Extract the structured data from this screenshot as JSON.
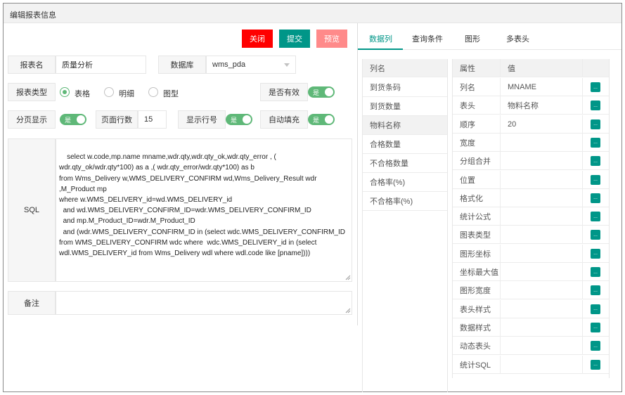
{
  "window": {
    "title": "编辑报表信息"
  },
  "toolbar": {
    "close_label": "关闭",
    "submit_label": "提交",
    "preview_label": "预览"
  },
  "colors": {
    "close": "#ff0000",
    "submit": "#009688",
    "preview": "#ff8a8a",
    "switch_on": "#5fb878",
    "accent": "#009688"
  },
  "form": {
    "report_name_label": "报表名",
    "report_name_value": "质量分析",
    "database_label": "数据库",
    "database_value": "wms_pda",
    "report_type_label": "报表类型",
    "report_type_options": [
      {
        "label": "表格",
        "selected": true
      },
      {
        "label": "明细",
        "selected": false
      },
      {
        "label": "图型",
        "selected": false
      }
    ],
    "valid_label": "是否有效",
    "valid_switch_text": "是",
    "paging_label": "分页显示",
    "paging_switch_text": "是",
    "page_rows_label": "页面行数",
    "page_rows_value": "15",
    "show_rownum_label": "显示行号",
    "show_rownum_switch_text": "是",
    "autofill_label": "自动填充",
    "autofill_switch_text": "是",
    "sql_label": "SQL",
    "sql_value": "select w.code,mp.name mname,wdr.qty,wdr.qty_ok,wdr.qty_error , ( wdr.qty_ok/wdr.qty*100) as a ,( wdr.qty_error/wdr.qty*100) as b\nfrom Wms_Delivery w,WMS_DELIVERY_CONFIRM wd,Wms_Delivery_Result wdr ,M_Product mp\nwhere w.WMS_DELIVERY_id=wd.WMS_DELIVERY_id\n  and wd.WMS_DELIVERY_CONFIRM_ID=wdr.WMS_DELIVERY_CONFIRM_ID\n  and mp.M_Product_ID=wdr.M_Product_ID\n  and (wdr.WMS_DELIVERY_CONFIRM_ID in (select wdc.WMS_DELIVERY_CONFIRM_ID from WMS_DELIVERY_CONFIRM wdc where  wdc.WMS_DELIVERY_id in (select wdl.WMS_DELIVERY_id from Wms_Delivery wdl where wdl.code like [pname])))",
    "remark_label": "备注",
    "remark_value": ""
  },
  "tabs": [
    {
      "label": "数据列",
      "active": true
    },
    {
      "label": "查询条件",
      "active": false
    },
    {
      "label": "图形",
      "active": false
    },
    {
      "label": "多表头",
      "active": false
    }
  ],
  "columns": {
    "header": "列名",
    "items": [
      {
        "label": "到货条码",
        "selected": false
      },
      {
        "label": "到货数量",
        "selected": false
      },
      {
        "label": "物料名称",
        "selected": true
      },
      {
        "label": "合格数量",
        "selected": false
      },
      {
        "label": "不合格数量",
        "selected": false
      },
      {
        "label": "合格率(%)",
        "selected": false
      },
      {
        "label": "不合格率(%)",
        "selected": false
      }
    ]
  },
  "properties": {
    "header_attr": "属性",
    "header_value": "值",
    "button_glyph": "...",
    "rows": [
      {
        "attr": "列名",
        "value": "MNAME"
      },
      {
        "attr": "表头",
        "value": "物料名称"
      },
      {
        "attr": "顺序",
        "value": "20"
      },
      {
        "attr": "宽度",
        "value": ""
      },
      {
        "attr": "分组合并",
        "value": ""
      },
      {
        "attr": "位置",
        "value": ""
      },
      {
        "attr": "格式化",
        "value": ""
      },
      {
        "attr": "统计公式",
        "value": ""
      },
      {
        "attr": "图表类型",
        "value": ""
      },
      {
        "attr": "图形坐标",
        "value": ""
      },
      {
        "attr": "坐标最大值",
        "value": ""
      },
      {
        "attr": "图形宽度",
        "value": ""
      },
      {
        "attr": "表头样式",
        "value": ""
      },
      {
        "attr": "数据样式",
        "value": ""
      },
      {
        "attr": "动态表头",
        "value": ""
      },
      {
        "attr": "统计SQL",
        "value": ""
      }
    ]
  }
}
